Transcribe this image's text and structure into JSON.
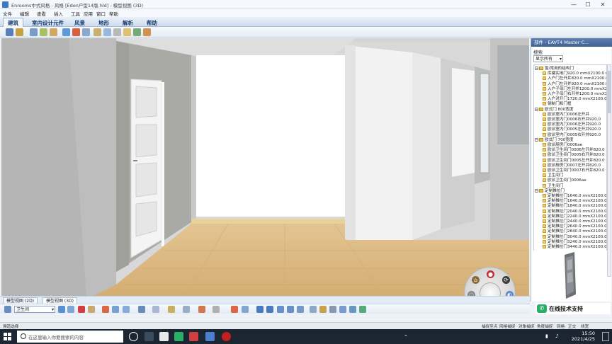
{
  "window": {
    "title": "Enrooms中式风格 - 风格 [Eden户型14版.hld] - 模型视图 (3D)",
    "controls": [
      "—",
      "☐",
      "✕"
    ]
  },
  "menu": [
    "文件",
    "编辑",
    "查看",
    "插入",
    "工具",
    "应用",
    "窗口",
    "帮助"
  ],
  "tabs": [
    "建筑",
    "室内设计元件",
    "风景",
    "地形",
    "解析",
    "帮助"
  ],
  "right_panel": {
    "header": "部件 - EAVT4 Master C...",
    "search_label": "搜索",
    "filter_value": "显示所有",
    "tree": [
      {
        "level": 0,
        "kind": "folder",
        "label": "窗/常用的结构门"
      },
      {
        "level": 1,
        "kind": "leaf",
        "label": "库建实用门920.0 mmX2100.0 m"
      },
      {
        "level": 1,
        "kind": "leaf",
        "label": "入户门左开并820.0 mmX2100.0 m"
      },
      {
        "level": 1,
        "kind": "leaf",
        "label": "入户门左开并920.0 mmX2100.0 m"
      },
      {
        "level": 1,
        "kind": "leaf",
        "label": "入户子母门左开并1200.0 mmX2"
      },
      {
        "level": 1,
        "kind": "leaf",
        "label": "入户子母门右开并1200.0 mmX2"
      },
      {
        "level": 1,
        "kind": "leaf",
        "label": "入户对开门1720.0 mmX2100.0 m"
      },
      {
        "level": 1,
        "kind": "leaf",
        "label": "钢制门和门框"
      },
      {
        "level": 0,
        "kind": "folder",
        "label": "欧式门 800宽度"
      },
      {
        "level": 1,
        "kind": "leaf",
        "label": "欧派室内门0006左开并"
      },
      {
        "level": 1,
        "kind": "leaf",
        "label": "欧派室内门0006右开并920.0"
      },
      {
        "level": 1,
        "kind": "leaf",
        "label": "欧派室内门0006左开并920.0"
      },
      {
        "level": 1,
        "kind": "leaf",
        "label": "欧派室内门0005左开并920.0"
      },
      {
        "level": 1,
        "kind": "leaf",
        "label": "欧派室内门0005右开并920.0"
      },
      {
        "level": 0,
        "kind": "folder",
        "label": "欧式门 700宽度"
      },
      {
        "level": 1,
        "kind": "leaf",
        "label": "欧派厨房门0006ae"
      },
      {
        "level": 1,
        "kind": "leaf",
        "label": "欧派卫生间门0006左开并820.0"
      },
      {
        "level": 1,
        "kind": "leaf",
        "label": "欧派卫生间门0005右开并820.0"
      },
      {
        "level": 1,
        "kind": "leaf",
        "label": "欧派卫生间门0005左开并820.0"
      },
      {
        "level": 1,
        "kind": "leaf",
        "label": "欧派厨房门0007左开并820.0"
      },
      {
        "level": 1,
        "kind": "leaf",
        "label": "欧派卫生间门0007右开并820.0"
      },
      {
        "level": 1,
        "kind": "leaf",
        "label": "卫生间门"
      },
      {
        "level": 1,
        "kind": "leaf",
        "label": "欧派卫生间门0006ae"
      },
      {
        "level": 1,
        "kind": "leaf",
        "label": "卫生间门"
      },
      {
        "level": 0,
        "kind": "folder",
        "label": "定制推拉门"
      },
      {
        "level": 1,
        "kind": "leaf",
        "label": "定制推拉门1640.0 mmX2100.0 n"
      },
      {
        "level": 1,
        "kind": "leaf",
        "label": "定制推拉门1640.0 mmX2100.0 n"
      },
      {
        "level": 1,
        "kind": "leaf",
        "label": "定制推拉门1840.0 mmX2100.0 n"
      },
      {
        "level": 1,
        "kind": "leaf",
        "label": "定制推拉门2040.0 mmX2100.0 n"
      },
      {
        "level": 1,
        "kind": "leaf",
        "label": "定制推拉门2240.0 mmX2100.0 n"
      },
      {
        "level": 1,
        "kind": "leaf",
        "label": "定制推拉门2440.0 mmX2100.0 n"
      },
      {
        "level": 1,
        "kind": "leaf",
        "label": "定制推拉门2640.0 mmX2100.0 n"
      },
      {
        "level": 1,
        "kind": "leaf",
        "label": "定制推拉门2840.0 mmX2100.0 n"
      },
      {
        "level": 1,
        "kind": "leaf",
        "label": "定制推拉门3040.0 mmX2100.0 n"
      },
      {
        "level": 1,
        "kind": "leaf",
        "label": "定制推拉门3240.0 mmX2100.0 n"
      },
      {
        "level": 1,
        "kind": "leaf",
        "label": "定制推拉门3440.0 mmX2100.0 n"
      }
    ]
  },
  "view_tabs": [
    "模型视图 (2D)",
    "模型视图 (3D)"
  ],
  "room_select": "卫生间",
  "support_label": "在线技术支持",
  "status": {
    "left": "佣造选择",
    "right_items": [
      "捕捉至点",
      "网格捕捉",
      "对象捕捉",
      "角度捕捉",
      "网格",
      "正交",
      "线宽"
    ]
  },
  "taskbar": {
    "search_placeholder": "在这里输入你要搜索的内容",
    "time": "15:50",
    "date": "2021/4/25"
  },
  "colors": {
    "accent": "#3f5f92",
    "floor": "#d9b784",
    "wall_left": "#b9b9b9",
    "wall_back": "#ffffff",
    "taskbar": "#1c2532"
  }
}
